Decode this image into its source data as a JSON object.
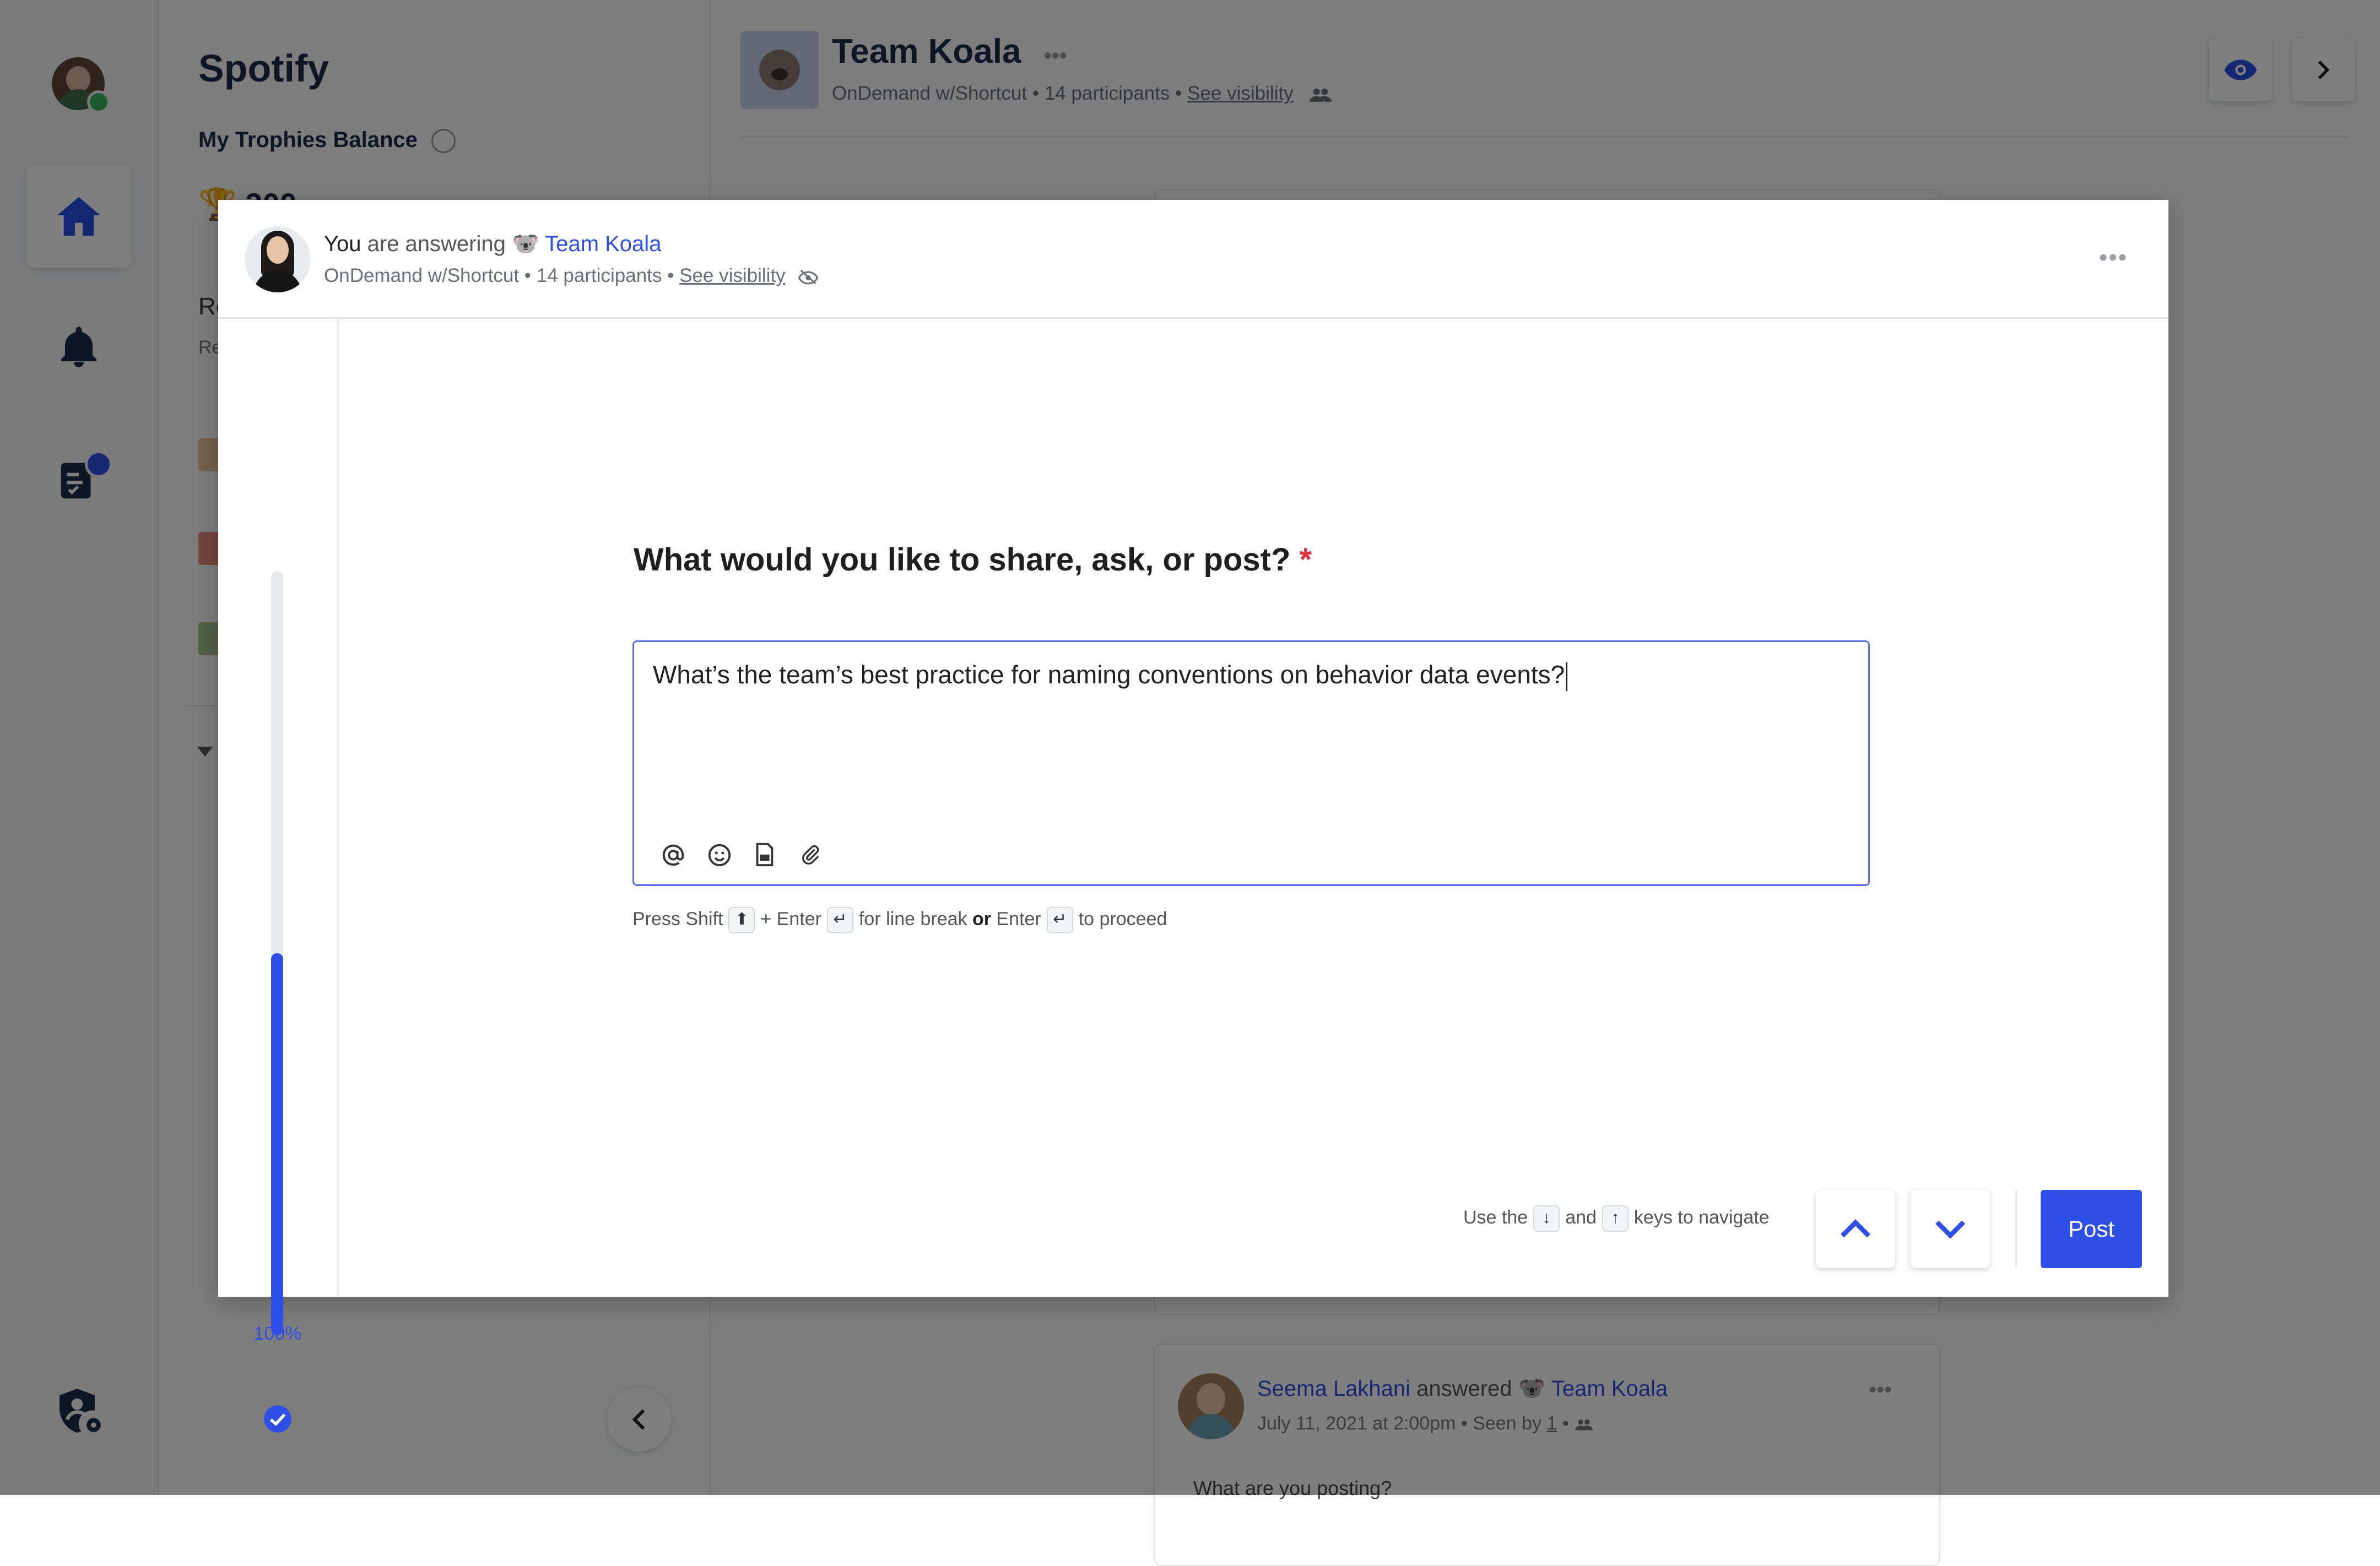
{
  "rail": {
    "icons": [
      "avatar",
      "home-icon",
      "bell-icon",
      "tasks-icon",
      "admin-shield-icon"
    ],
    "accent": "#2d4fe5"
  },
  "sidebar": {
    "org_name": "Spotify",
    "trophies_label": "My Trophies Balance",
    "trophies_value": "300",
    "section_initial": "Re",
    "section_sub": "Re"
  },
  "header": {
    "team_name": "Team Koala",
    "meta_source": "OnDemand w/Shortcut",
    "meta_participants": "14 participants",
    "meta_visibility": "See visibility"
  },
  "feed_post": {
    "author": "Seema Lakhani",
    "verb": "answered",
    "team": "Team Koala",
    "time": "July 11, 2021 at 2:00pm",
    "seen_by_label": "Seen by",
    "seen_by_count": "1",
    "preview": "What are you posting?"
  },
  "modal": {
    "you": "You",
    "answering": "are answering",
    "team": "Team Koala",
    "meta_source": "OnDemand w/Shortcut",
    "meta_participants": "14 participants",
    "meta_visibility": "See visibility",
    "progress_percent": 100,
    "progress_label": "100%",
    "question": "What would you like to share, ask, or post?",
    "required_mark": "*",
    "answer": "What’s the team’s best practice for naming conventions on behavior data events?",
    "hint": {
      "press": "Press Shift",
      "plus_enter": "+ Enter",
      "for_line_break": "for line break",
      "or": "or",
      "enter": "Enter",
      "to_proceed": "to proceed"
    },
    "nav_hint": {
      "use_the": "Use the",
      "and": "and",
      "keys": "keys to navigate"
    },
    "post_button": "Post",
    "toolbar_icons": [
      "mention-icon",
      "emoji-icon",
      "gif-icon",
      "attach-icon"
    ]
  },
  "colors": {
    "accent": "#2d4fe5",
    "required": "#e0303a",
    "overlay": "rgba(0,0,0,0.5)"
  }
}
